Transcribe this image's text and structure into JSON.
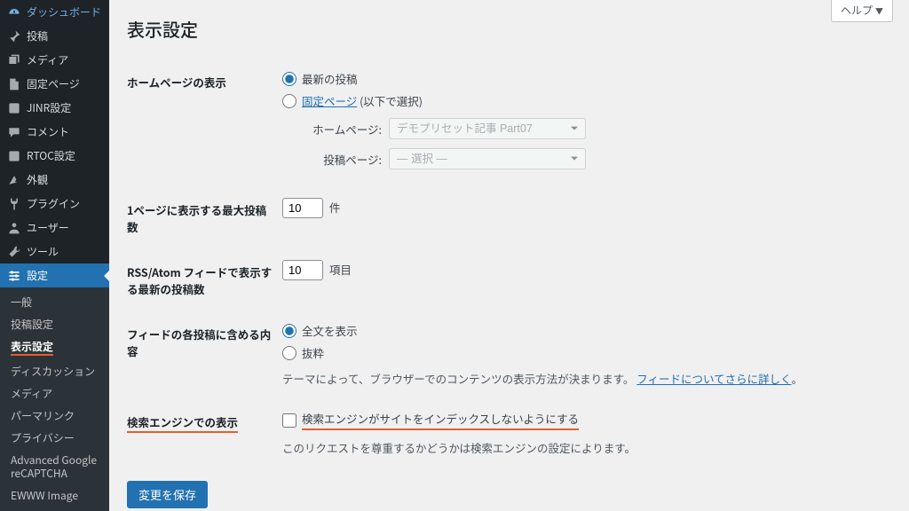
{
  "help_label": "ヘルプ",
  "page_title": "表示設定",
  "sidebar": {
    "items": [
      {
        "label": "ダッシュボード",
        "icon": "dashboard"
      },
      {
        "label": "投稿",
        "icon": "pin"
      },
      {
        "label": "メディア",
        "icon": "media"
      },
      {
        "label": "固定ページ",
        "icon": "page"
      },
      {
        "label": "JINR設定",
        "icon": "jinr"
      },
      {
        "label": "コメント",
        "icon": "comment"
      },
      {
        "label": "RTOC設定",
        "icon": "rtoc"
      },
      {
        "label": "外観",
        "icon": "appearance"
      },
      {
        "label": "プラグイン",
        "icon": "plugin"
      },
      {
        "label": "ユーザー",
        "icon": "user"
      },
      {
        "label": "ツール",
        "icon": "tool"
      },
      {
        "label": "設定",
        "icon": "settings",
        "current": true
      }
    ],
    "submenu": [
      "一般",
      "投稿設定",
      "表示設定",
      "ディスカッション",
      "メディア",
      "パーマリンク",
      "プライバシー",
      "Advanced Google reCAPTCHA",
      "EWWW Image"
    ],
    "submenu_current_index": 2
  },
  "rows": {
    "homepage": {
      "label": "ホームページの表示",
      "opt_latest": "最新の投稿",
      "opt_static_link": "固定ページ",
      "opt_static_suffix": " (以下で選択)",
      "home_label": "ホームページ:",
      "home_value": "デモプリセット記事 Part07",
      "posts_label": "投稿ページ:",
      "posts_value": "— 選択 —"
    },
    "per_page": {
      "label": "1ページに表示する最大投稿数",
      "value": "10",
      "unit": "件"
    },
    "feed_count": {
      "label": "RSS/Atom フィードで表示する最新の投稿数",
      "value": "10",
      "unit": "項目"
    },
    "feed_content": {
      "label": "フィードの各投稿に含める内容",
      "opt_full": "全文を表示",
      "opt_excerpt": "抜粋",
      "desc_pre": "テーマによって、ブラウザーでのコンテンツの表示方法が決まります。",
      "desc_link": "フィードについてさらに詳しく",
      "desc_post": "。"
    },
    "search_engine": {
      "label": "検索エンジンでの表示",
      "checkbox_label": "検索エンジンがサイトをインデックスしないようにする",
      "desc": "このリクエストを尊重するかどうかは検索エンジンの設定によります。"
    }
  },
  "submit_label": "変更を保存"
}
